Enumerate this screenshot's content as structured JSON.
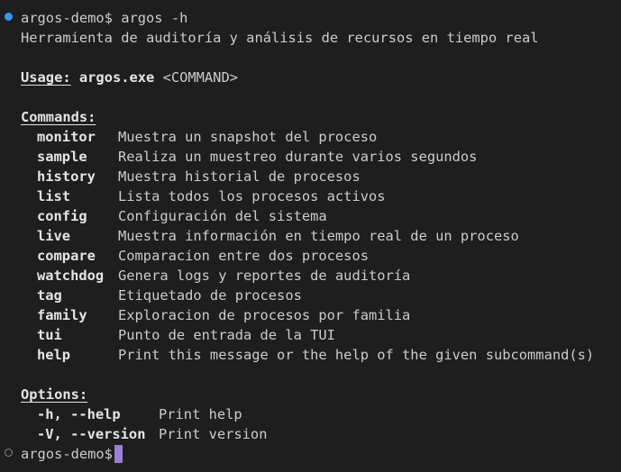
{
  "session1": {
    "prompt": "argos-demo$",
    "command": "argos -h"
  },
  "description": "Herramienta de auditoría y análisis de recursos en tiempo real",
  "usage": {
    "label": "Usage:",
    "binary": "argos.exe",
    "args": "<COMMAND>"
  },
  "commands": {
    "heading": "Commands:",
    "items": [
      {
        "name": "monitor",
        "desc": "Muestra un snapshot del proceso"
      },
      {
        "name": "sample",
        "desc": "Realiza un muestreo durante varios segundos"
      },
      {
        "name": "history",
        "desc": "Muestra historial de procesos"
      },
      {
        "name": "list",
        "desc": "Lista todos los procesos activos"
      },
      {
        "name": "config",
        "desc": "Configuración del sistema"
      },
      {
        "name": "live",
        "desc": "Muestra información en tiempo real de un proceso"
      },
      {
        "name": "compare",
        "desc": "Comparacion entre dos procesos"
      },
      {
        "name": "watchdog",
        "desc": "Genera logs y reportes de auditoría"
      },
      {
        "name": "tag",
        "desc": "Etiquetado de procesos"
      },
      {
        "name": "family",
        "desc": "Exploracion de procesos por familia"
      },
      {
        "name": "tui",
        "desc": "Punto de entrada de la TUI"
      },
      {
        "name": "help",
        "desc": "Print this message or the help of the given subcommand(s)"
      }
    ]
  },
  "options": {
    "heading": "Options:",
    "items": [
      {
        "flag": "-h, --help",
        "desc": "Print help"
      },
      {
        "flag": "-V, --version",
        "desc": "Print version"
      }
    ]
  },
  "session2": {
    "prompt": "argos-demo$"
  },
  "colors": {
    "background": "#1e1e1e",
    "foreground": "#cccccc",
    "success_marker": "#3794ff",
    "idle_marker": "#8a8a8a",
    "cursor": "#9d7fd6"
  }
}
